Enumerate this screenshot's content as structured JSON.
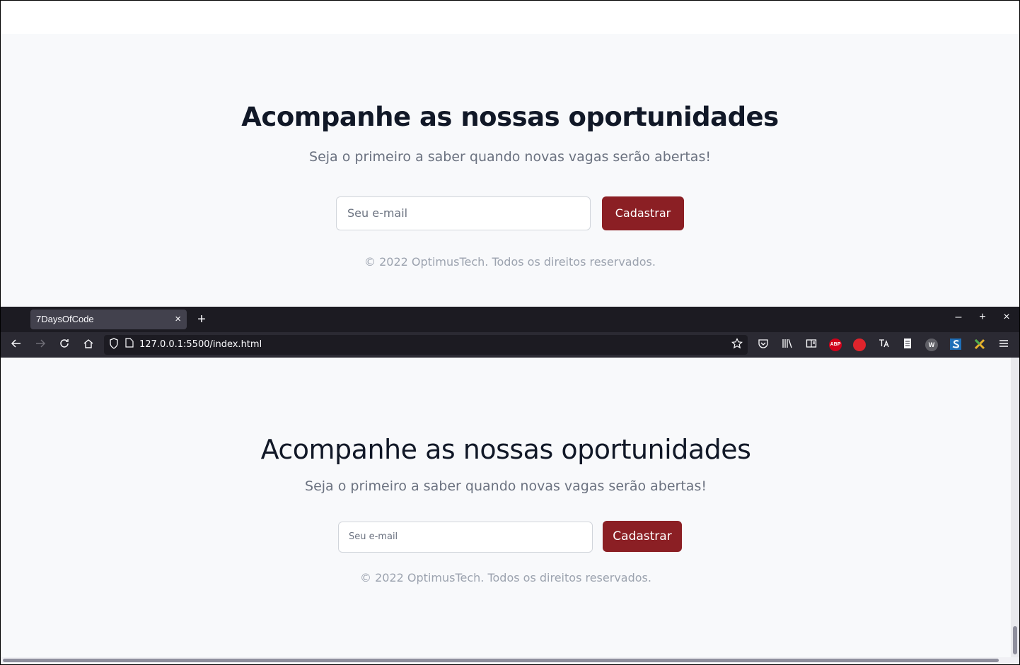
{
  "design": {
    "title": "Acompanhe as nossas oportunidades",
    "subtitle": "Seja o primeiro a saber quando novas vagas serão abertas!",
    "email_placeholder": "Seu e-mail",
    "button_label": "Cadastrar",
    "copyright": "© 2022 OptimusTech. Todos os direitos reservados."
  },
  "browser": {
    "tab_title": "7DaysOfCode",
    "tab_close": "×",
    "new_tab": "+",
    "minimize": "–",
    "maximize": "+",
    "close": "×",
    "url": "127.0.0.1:5500/index.html",
    "extensions": [
      "ABP",
      "W"
    ]
  },
  "page": {
    "title": "Acompanhe as nossas oportunidades",
    "subtitle": "Seja o primeiro a saber quando novas vagas serão abertas!",
    "email_placeholder": "Seu e-mail",
    "button_label": "Cadastrar",
    "copyright": "© 2022 OptimusTech. Todos os direitos reservados."
  },
  "colors": {
    "accent": "#8b1f24",
    "heading": "#111827",
    "muted": "#6b7280",
    "chrome_dark": "#1c1b22",
    "toolbar": "#2b2a33"
  }
}
